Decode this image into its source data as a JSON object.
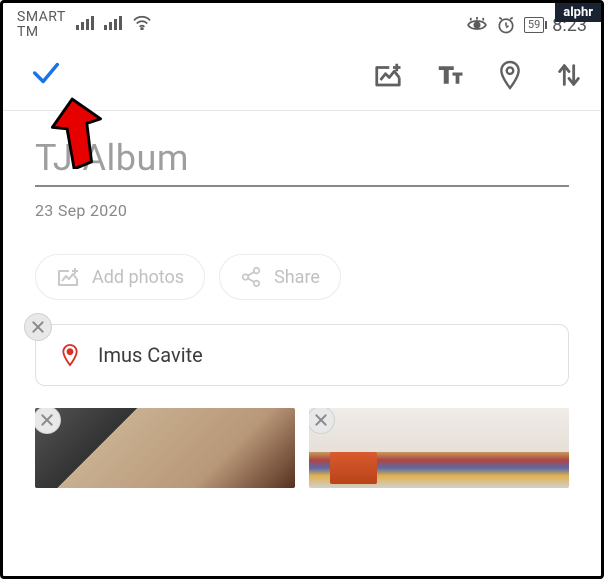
{
  "watermark": "alphr",
  "status": {
    "carrier_line1": "SMART",
    "carrier_line2": "TM",
    "battery": "59",
    "time": "8:23"
  },
  "album": {
    "title": "TJ Album",
    "date": "23 Sep 2020"
  },
  "actions": {
    "add_photos": "Add photos",
    "share": "Share"
  },
  "location": {
    "text": "Imus Cavite"
  }
}
